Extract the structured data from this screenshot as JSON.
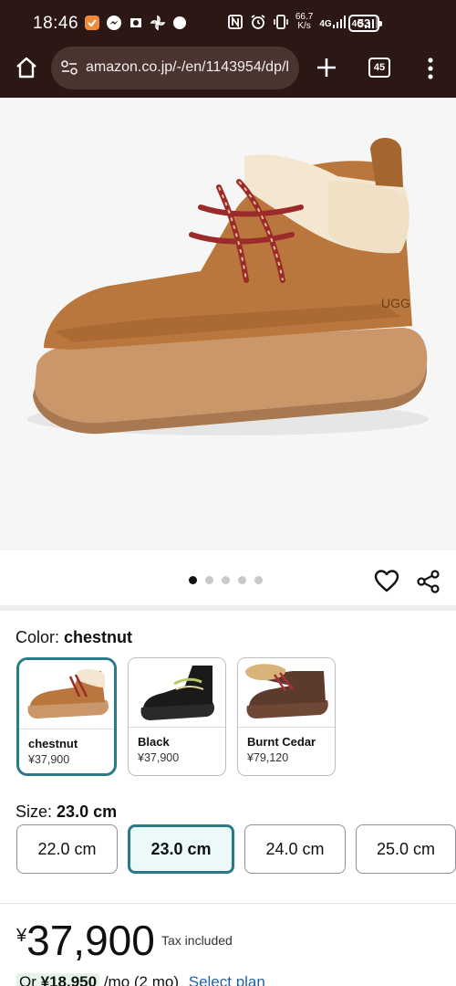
{
  "status_bar": {
    "time": "18:46",
    "speed_value": "66.7",
    "speed_unit": "K/s",
    "network_1": "4G",
    "network_2": "4G",
    "battery": "53"
  },
  "browser": {
    "url": "amazon.co.jp/-/en/1143954/dp/l",
    "tab_count": "45"
  },
  "carousel": {
    "dot_count": 5,
    "active_index": 0
  },
  "color": {
    "label": "Color:",
    "selected": "chestnut",
    "options": [
      {
        "name": "chestnut",
        "price": "¥37,900"
      },
      {
        "name": "Black",
        "price": "¥37,900"
      },
      {
        "name": "Burnt Cedar",
        "price": "¥79,120"
      }
    ]
  },
  "size": {
    "label": "Size:",
    "selected": "23.0 cm",
    "options": [
      "22.0 cm",
      "23.0 cm",
      "24.0 cm",
      "25.0 cm"
    ]
  },
  "price": {
    "currency": "¥",
    "amount": "37,900",
    "tax_note": "Tax included",
    "installment_prefix": "Or",
    "installment_amount": "¥18,950",
    "installment_term": "/mo (2 mo)",
    "select_plan": "Select plan"
  },
  "colors": {
    "chrome_bg": "#2b1714",
    "selected_border": "#2b7a87",
    "selected_bg": "#ecf9fb",
    "link": "#2162a1"
  }
}
